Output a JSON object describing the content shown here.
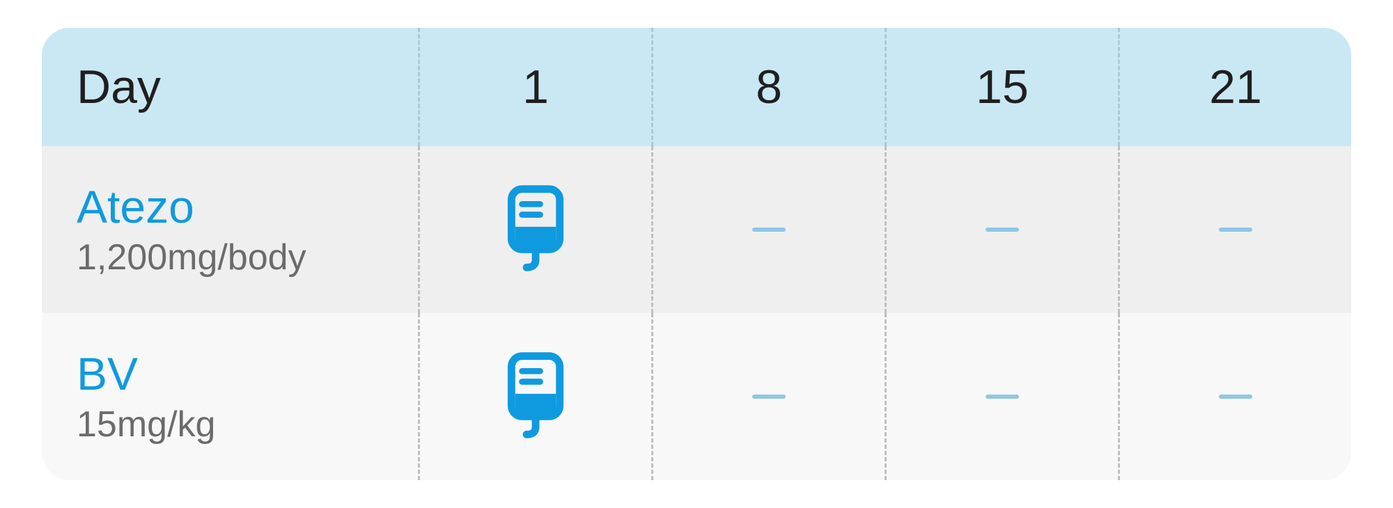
{
  "header": {
    "label": "Day",
    "days": [
      "1",
      "8",
      "15",
      "21"
    ]
  },
  "rows": [
    {
      "name": "Atezo",
      "dose": "1,200mg/body",
      "cells": [
        "iv",
        "dash",
        "dash",
        "dash"
      ]
    },
    {
      "name": "BV",
      "dose": "15mg/kg",
      "cells": [
        "iv",
        "dash",
        "dash",
        "dash"
      ]
    }
  ],
  "colors": {
    "accent": "#0f9ae0",
    "header_bg": "#cae7f4"
  }
}
